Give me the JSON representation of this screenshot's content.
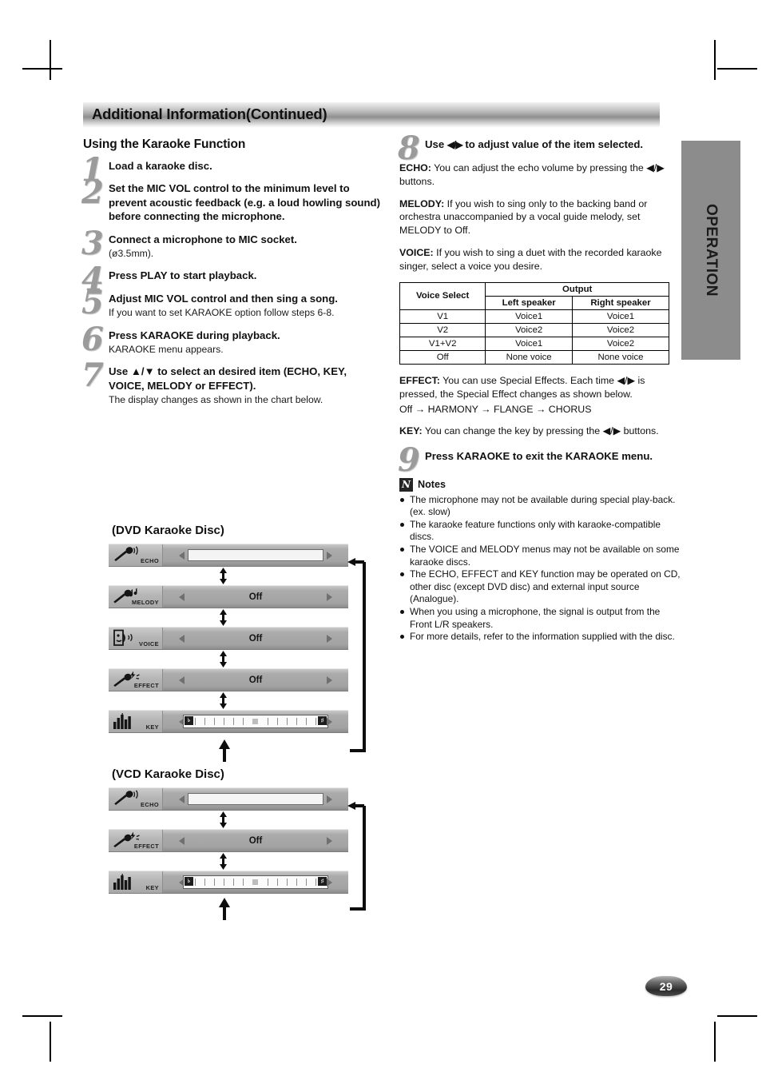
{
  "header": {
    "title": "Additional Information(Continued)"
  },
  "side_tab": {
    "label": "OPERATION"
  },
  "page_number": "29",
  "left": {
    "section_title": "Using the Karaoke Function",
    "steps": [
      {
        "num": "1",
        "head": "Load a karaoke disc.",
        "sub": ""
      },
      {
        "num": "2",
        "head": "Set the MIC VOL control to the minimum level to prevent acoustic feedback (e.g. a loud howling sound) before connecting the microphone.",
        "sub": ""
      },
      {
        "num": "3",
        "head": "Connect a microphone to MIC socket.",
        "sub": "(ø3.5mm)."
      },
      {
        "num": "4",
        "head": "Press PLAY to start playback.",
        "sub": ""
      },
      {
        "num": "5",
        "head": "Adjust MIC VOL control and then sing a song.",
        "sub": "If you want to set KARAOKE option follow steps 6-8."
      },
      {
        "num": "6",
        "head": "Press KARAOKE during playback.",
        "sub": "KARAOKE menu appears."
      },
      {
        "num": "7",
        "head": "Use ▲/▼ to select an desired item (ECHO, KEY, VOICE, MELODY or EFFECT).",
        "sub": "The display changes as shown in the chart below."
      }
    ]
  },
  "right": {
    "step8": {
      "num": "8",
      "head_part1": "Use ",
      "head_arrows": "◀/▶",
      "head_part2": " to adjust value of the item selected."
    },
    "paragraphs": [
      {
        "label": "ECHO:",
        "text": " You can adjust the echo volume by pressing the ◀/▶ buttons."
      },
      {
        "label": "MELODY:",
        "text": " If you wish to sing only to the backing band or orchestra unaccompanied by a vocal guide melody, set MELODY to Off."
      },
      {
        "label": "VOICE:",
        "text": " If you wish to sing a duet with the recorded karaoke singer, select a voice you desire."
      }
    ],
    "voice_table": {
      "col1_header": "Voice Select",
      "group_header": "Output",
      "sub_headers": [
        "Left speaker",
        "Right speaker"
      ],
      "rows": [
        [
          "V1",
          "Voice1",
          "Voice1"
        ],
        [
          "V2",
          "Voice2",
          "Voice2"
        ],
        [
          "V1+V2",
          "Voice1",
          "Voice2"
        ],
        [
          "Off",
          "None voice",
          "None voice"
        ]
      ]
    },
    "effect": {
      "label": "EFFECT:",
      "text": " You can use Special Effects. Each time ◀/▶ is pressed, the Special Effect changes as shown below.",
      "sequence": "Off → HARMONY → FLANGE → CHORUS"
    },
    "key": {
      "label": "KEY:",
      "text": " You can change the key by pressing the ◀/▶ buttons."
    },
    "step9": {
      "num": "9",
      "head": "Press KARAOKE to exit the KARAOKE menu."
    },
    "notes": {
      "badge": "N",
      "title": "Notes",
      "items": [
        "The microphone may not be available during special play-back. (ex. slow)",
        "The karaoke feature functions only with karaoke-compatible discs.",
        "The VOICE and MELODY menus may not be available on some karaoke discs.",
        "The ECHO, EFFECT and KEY function may be operated on CD, other disc (except DVD disc) and external input source (Analogue).",
        "When you using a microphone, the signal is output from the Front L/R speakers.",
        "For more details, refer to the information supplied with the disc."
      ]
    }
  },
  "diagrams": [
    {
      "title": "(DVD Karaoke Disc)",
      "rows": [
        {
          "icon": "mic-echo-icon",
          "caption": "ECHO",
          "control": "bar",
          "value": ""
        },
        {
          "icon": "mic-melody-icon",
          "caption": "MELODY",
          "control": "value",
          "value": "Off"
        },
        {
          "icon": "voice-face-icon",
          "caption": "VOICE",
          "control": "value",
          "value": "Off"
        },
        {
          "icon": "mic-effect-icon",
          "caption": "EFFECT",
          "control": "value",
          "value": "Off"
        },
        {
          "icon": "key-bars-icon",
          "caption": "KEY",
          "control": "key",
          "value": "",
          "key_left": "♭",
          "key_right": "♯"
        }
      ]
    },
    {
      "title": "(VCD Karaoke Disc)",
      "rows": [
        {
          "icon": "mic-echo-icon",
          "caption": "ECHO",
          "control": "bar",
          "value": ""
        },
        {
          "icon": "mic-effect-icon",
          "caption": "EFFECT",
          "control": "value",
          "value": "Off"
        },
        {
          "icon": "key-bars-icon",
          "caption": "KEY",
          "control": "key",
          "value": "",
          "key_left": "♭",
          "key_right": "♯"
        }
      ]
    }
  ]
}
